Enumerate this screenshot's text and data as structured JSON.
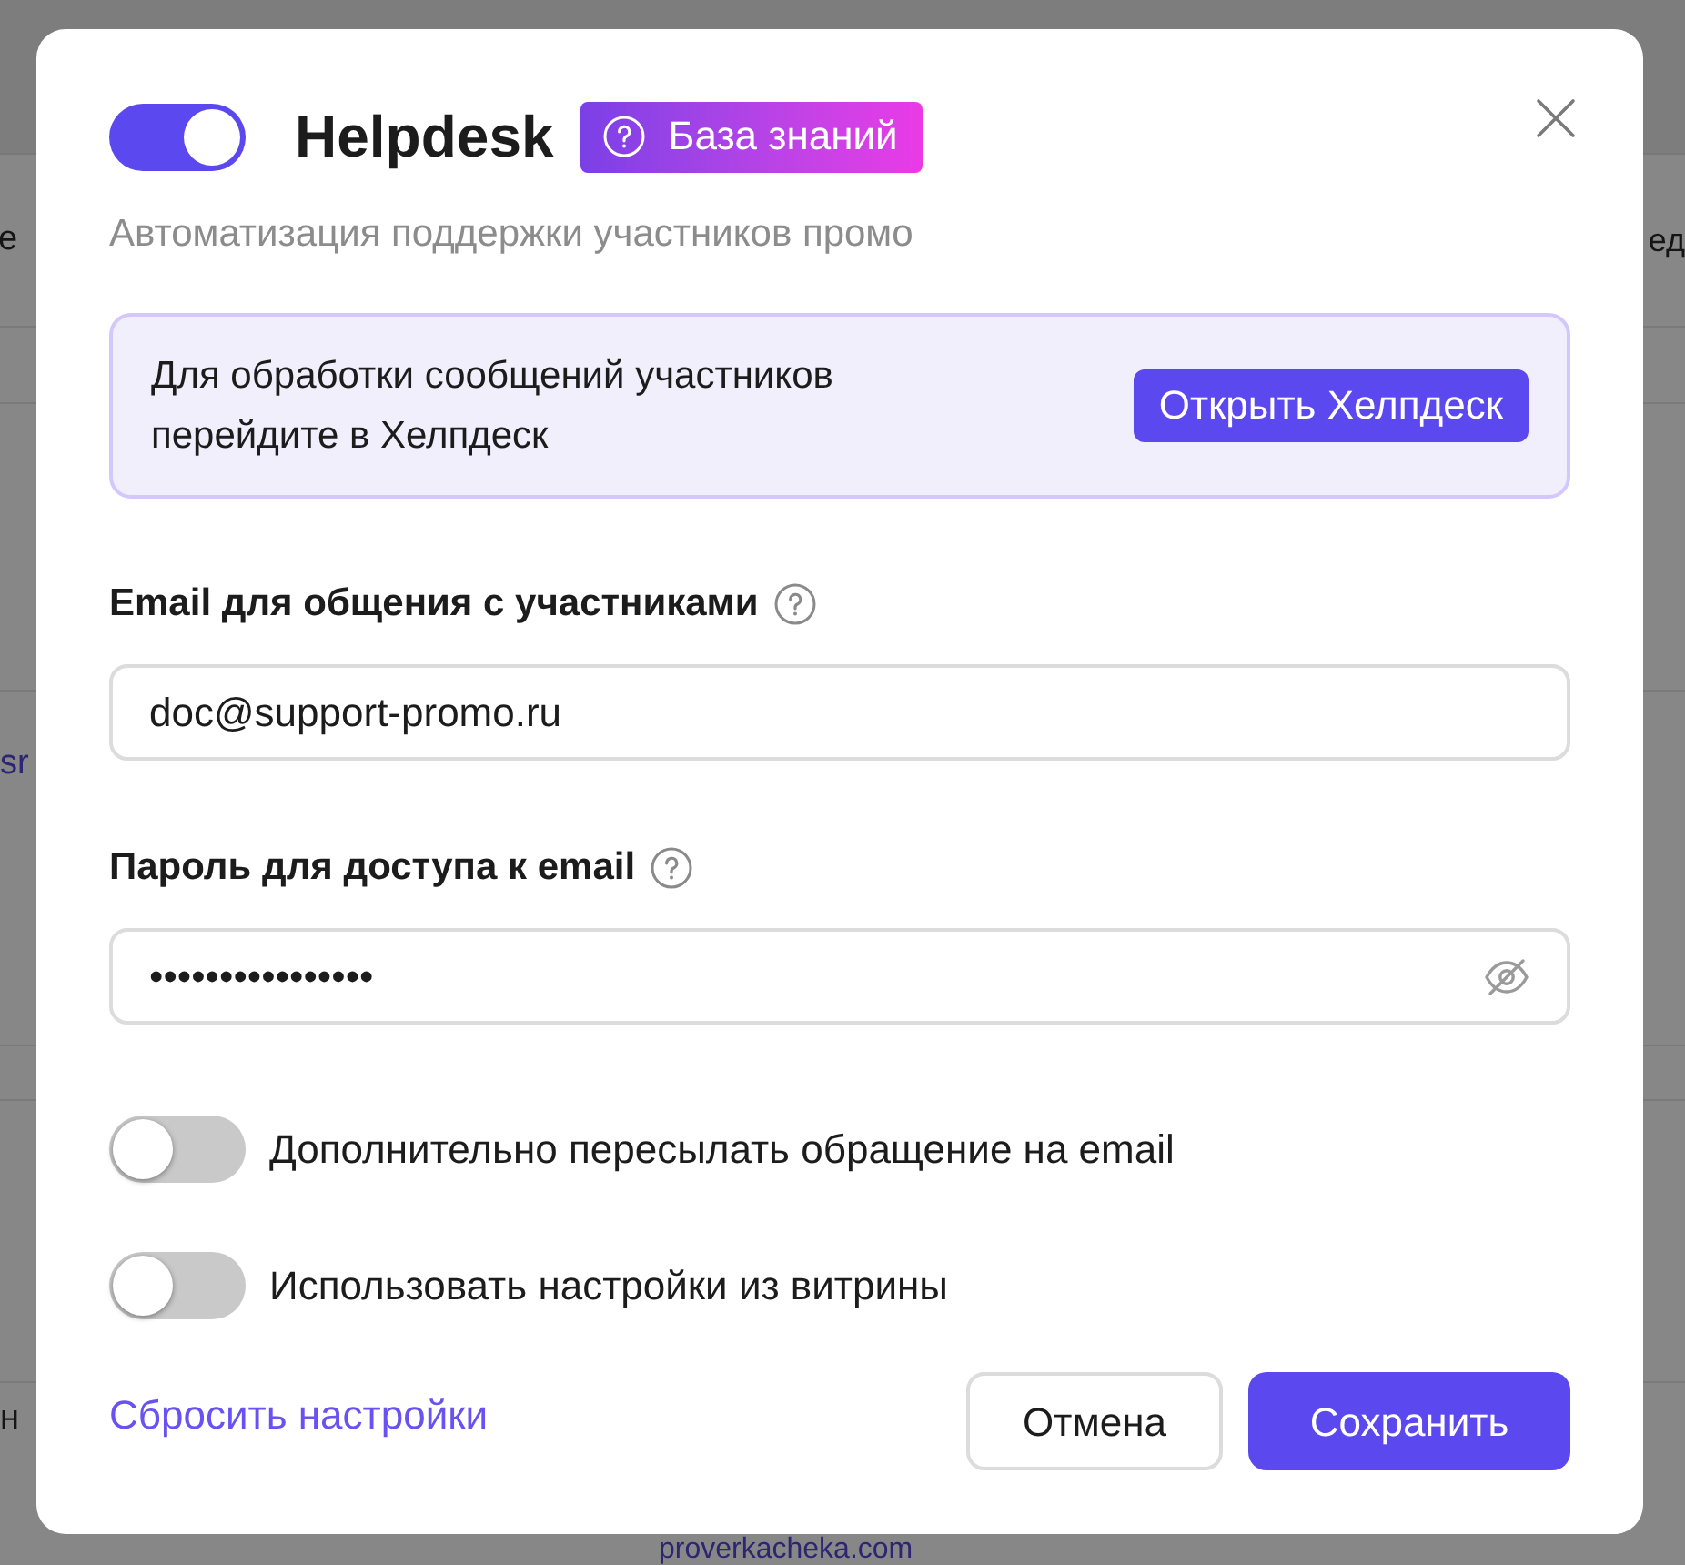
{
  "background": {
    "rows": [
      {
        "left_text": "е",
        "right_text": "ед"
      },
      {
        "left_link": "sr"
      },
      {
        "left_text": "н",
        "link": "proverkacheka.com"
      }
    ]
  },
  "dialog": {
    "enabled": true,
    "title": "Helpdesk",
    "badge": {
      "label": "База знаний"
    },
    "subtitle": "Автоматизация поддержки участников промо",
    "notice": {
      "text": "Для обработки сообщений участников\nперейдите в Хелпдеск",
      "button": "Открыть Хелпдеск"
    },
    "fields": [
      {
        "kind": "email",
        "label": "Email для общения с участниками",
        "value": "doc@support-promo.ru"
      },
      {
        "kind": "password",
        "label": "Пароль для доступа к email",
        "value": "••••••••••••••••"
      }
    ],
    "toggles": [
      {
        "label": "Дополнительно пересылать обращение на email",
        "on": false
      },
      {
        "label": "Использовать настройки из витрины",
        "on": false
      }
    ],
    "reset_link": "Сбросить настройки",
    "buttons": [
      {
        "kind": "secondary",
        "label": "Отмена"
      },
      {
        "kind": "primary",
        "label": "Сохранить"
      }
    ]
  }
}
